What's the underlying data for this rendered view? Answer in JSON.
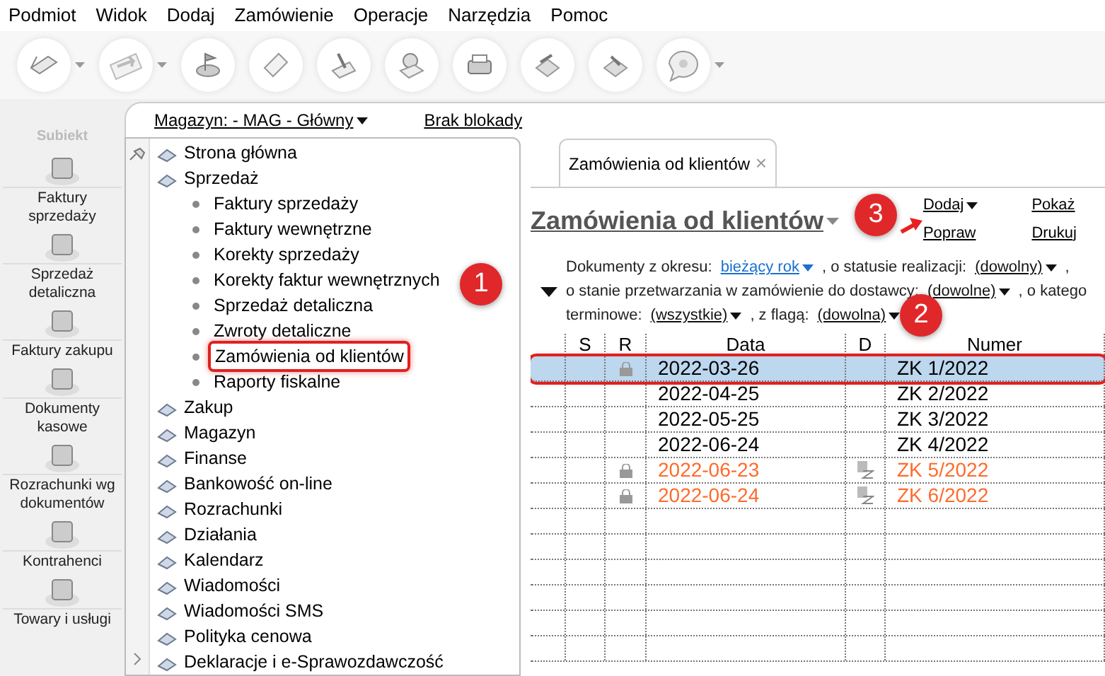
{
  "menu": [
    "Podmiot",
    "Widok",
    "Dodaj",
    "Zamówienie",
    "Operacje",
    "Narzędzia",
    "Pomoc"
  ],
  "toolbar": [
    {
      "caret": true
    },
    {
      "caret": true
    },
    {
      "caret": false
    },
    {
      "caret": false
    },
    {
      "caret": false
    },
    {
      "caret": false
    },
    {
      "caret": false
    },
    {
      "caret": false
    },
    {
      "caret": false
    },
    {
      "caret": true
    }
  ],
  "logo": {
    "text": "Subiekt"
  },
  "sidebar": {
    "items": [
      {
        "label": "Faktury sprzedaży"
      },
      {
        "label": "Sprzedaż detaliczna"
      },
      {
        "label": "Faktury zakupu"
      },
      {
        "label": "Dokumenty kasowe"
      },
      {
        "label": "Rozrachunki wg dokumentów"
      },
      {
        "label": "Kontrahenci"
      },
      {
        "label": "Towary i usługi"
      }
    ]
  },
  "top_bar": {
    "warehouse": "Magazyn: - MAG - Główny",
    "lock": "Brak blokady"
  },
  "tree": [
    {
      "label": "Strona główna",
      "selected": false
    },
    {
      "label": "Sprzedaż",
      "selected": false,
      "children": [
        {
          "label": "Faktury sprzedaży",
          "selected": false
        },
        {
          "label": "Faktury wewnętrzne",
          "selected": false
        },
        {
          "label": "Korekty sprzedaży",
          "selected": false
        },
        {
          "label": "Korekty faktur wewnętrznych",
          "selected": false
        },
        {
          "label": "Sprzedaż detaliczna",
          "selected": false
        },
        {
          "label": "Zwroty detaliczne",
          "selected": false
        },
        {
          "label": "Zamówienia od klientów",
          "selected": true
        },
        {
          "label": "Raporty fiskalne",
          "selected": false
        }
      ]
    },
    {
      "label": "Zakup",
      "selected": false
    },
    {
      "label": "Magazyn",
      "selected": false
    },
    {
      "label": "Finanse",
      "selected": false
    },
    {
      "label": "Bankowość on-line",
      "selected": false
    },
    {
      "label": "Rozrachunki",
      "selected": false
    },
    {
      "label": "Działania",
      "selected": false
    },
    {
      "label": "Kalendarz",
      "selected": false
    },
    {
      "label": "Wiadomości",
      "selected": false
    },
    {
      "label": "Wiadomości SMS",
      "selected": false
    },
    {
      "label": "Polityka cenowa",
      "selected": false
    },
    {
      "label": "Deklaracje i e-Sprawozdawczość",
      "selected": false
    }
  ],
  "tab": {
    "label": "Zamówienia od klientów",
    "close": "×"
  },
  "title": "Zamówienia od klientów",
  "actions": [
    [
      "Dodaj",
      "Popraw"
    ],
    [
      "Pokaż",
      "Drukuj"
    ]
  ],
  "action_carets": [
    [
      true,
      false
    ],
    [
      false,
      false
    ]
  ],
  "filters": [
    [
      {
        "kind": "text",
        "text": "Dokumenty z okresu:"
      },
      {
        "kind": "period",
        "text": "bieżący rok"
      },
      {
        "kind": "text",
        "text": ", o statusie realizacji:"
      },
      {
        "kind": "dropdown",
        "text": "(dowolny)"
      },
      {
        "kind": "text",
        "text": ","
      }
    ],
    [
      {
        "kind": "text",
        "text": "o stanie przetwarzania w zamówienie do dostawcy:"
      },
      {
        "kind": "dropdown",
        "text": "(dowolne)"
      },
      {
        "kind": "text",
        "text": ", o katego"
      }
    ],
    [
      {
        "kind": "text",
        "text": "terminowe:"
      },
      {
        "kind": "dropdown",
        "text": "(wszystkie)"
      },
      {
        "kind": "text",
        "text": ", z flagą:"
      },
      {
        "kind": "dropdown",
        "text": "(dowolna)"
      }
    ]
  ],
  "table": {
    "columns": [
      "S",
      "R",
      "Data",
      "D",
      "Numer"
    ],
    "rows": [
      {
        "date": "2022-03-26",
        "number": "ZK 1/2022",
        "locked": true,
        "d_mark": false,
        "color": "#000000",
        "selected": true
      },
      {
        "date": "2022-04-25",
        "number": "ZK 2/2022",
        "locked": false,
        "d_mark": false,
        "color": "#000000",
        "selected": false
      },
      {
        "date": "2022-05-25",
        "number": "ZK 3/2022",
        "locked": false,
        "d_mark": false,
        "color": "#000000",
        "selected": false
      },
      {
        "date": "2022-06-24",
        "number": "ZK 4/2022",
        "locked": false,
        "d_mark": false,
        "color": "#000000",
        "selected": false
      },
      {
        "date": "2022-06-23",
        "number": "ZK 5/2022",
        "locked": true,
        "d_mark": true,
        "color": "#ff6a2b",
        "selected": false
      },
      {
        "date": "2022-06-24",
        "number": "ZK 6/2022",
        "locked": true,
        "d_mark": true,
        "color": "#ff6a2b",
        "selected": false
      }
    ]
  },
  "annotations": [
    "1",
    "2",
    "3"
  ]
}
